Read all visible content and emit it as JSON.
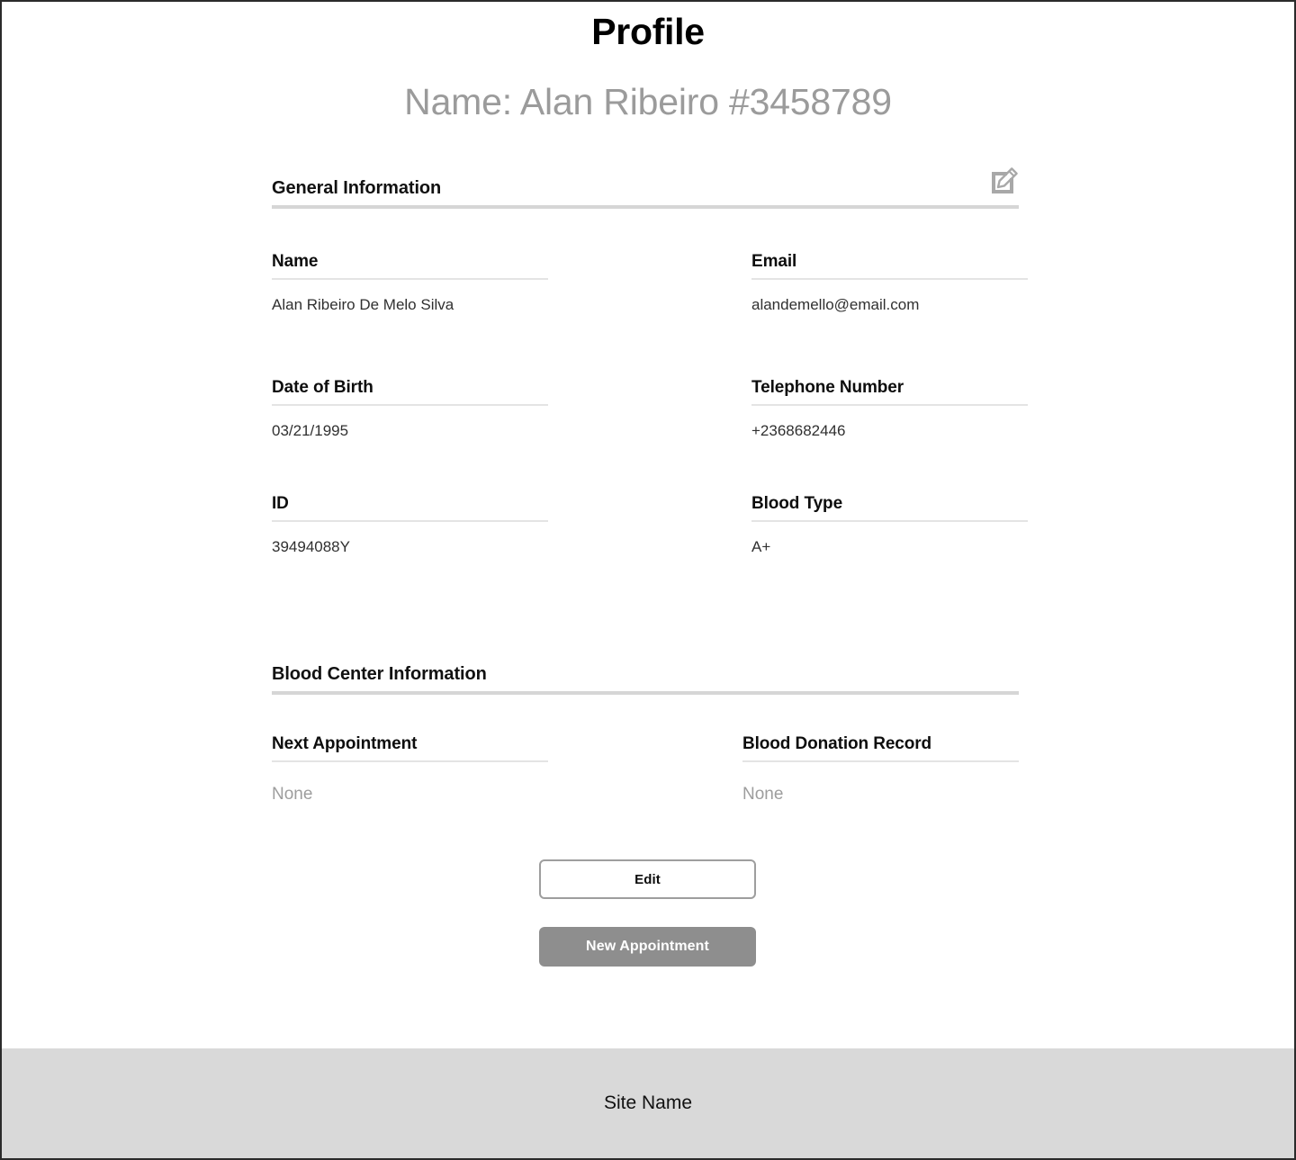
{
  "header": {
    "title": "Profile",
    "subtitle": "Name: Alan Ribeiro #3458789"
  },
  "sections": [
    {
      "id": "general-information",
      "title": "General Information",
      "edit_icon": "edit-pencil-icon",
      "fields": [
        {
          "label": "Name",
          "value": "Alan Ribeiro De Melo Silva",
          "muted": false
        },
        {
          "label": "Email",
          "value": "alandemello@email.com",
          "muted": false
        },
        {
          "label": "Date of Birth",
          "value": "03/21/1995",
          "muted": false
        },
        {
          "label": "Telephone Number",
          "value": "+2368682446",
          "muted": false
        },
        {
          "label": "ID",
          "value": "39494088Y",
          "muted": false
        },
        {
          "label": "Blood Type",
          "value": "A+",
          "muted": false
        }
      ]
    },
    {
      "id": "blood-center-information",
      "title": "Blood Center Information",
      "fields": [
        {
          "label": "Next Appointment",
          "value": "None",
          "muted": true
        },
        {
          "label": "Blood Donation Record",
          "value": "None",
          "muted": true
        }
      ]
    }
  ],
  "actions": {
    "edit_label": "Edit",
    "new_appointment_label": "New Appointment"
  },
  "footer": {
    "site_name": "Site Name"
  },
  "colors": {
    "page_border": "#2b2b2b",
    "subtitle": "#9b9b9b",
    "section_rule": "#d6d6d6",
    "field_underline": "#e4e4e4",
    "muted_value": "#9d9d9d",
    "primary_button_fill": "#8e8e8e",
    "footer_background": "#d9d9d9"
  }
}
